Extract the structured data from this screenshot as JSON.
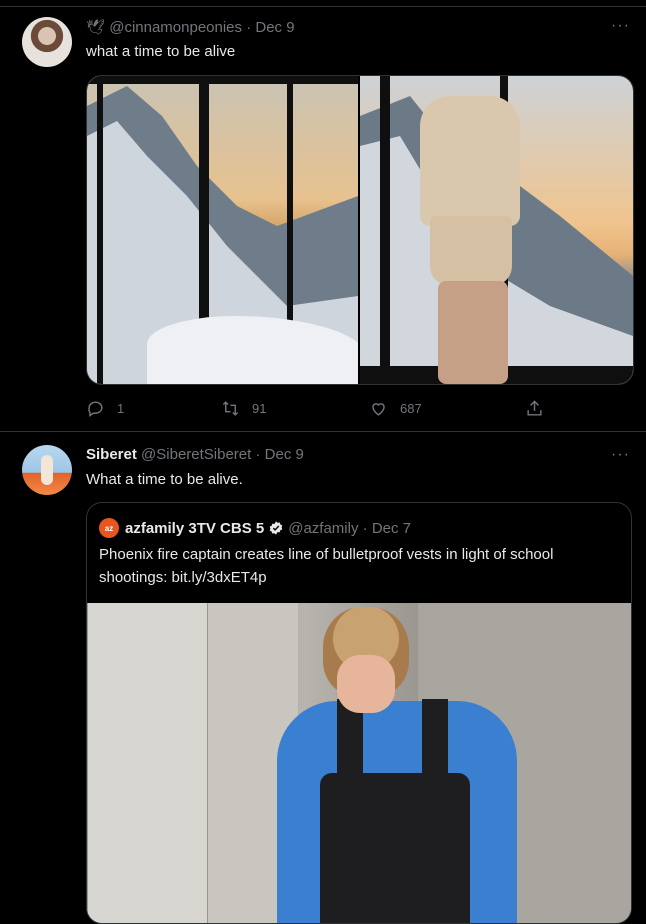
{
  "tweets": [
    {
      "handle": "@cinnamonpeonies",
      "separator": "·",
      "date": "Dec 9",
      "more": "···",
      "text": "what a time to be alive",
      "stats": {
        "replies": "1",
        "retweets": "91",
        "likes": "687"
      }
    },
    {
      "name": "Siberet",
      "handle": "@SiberetSiberet",
      "separator": "·",
      "date": "Dec 9",
      "more": "···",
      "text": "What a time to be alive.",
      "quote": {
        "avatar_text": "az",
        "name": "azfamily 3TV CBS 5",
        "handle": "@azfamily",
        "separator": "·",
        "date": "Dec 7",
        "text": "Phoenix fire captain creates line of bulletproof vests in light of school shootings: bit.ly/3dxET4p"
      }
    }
  ],
  "colors": {
    "background": "#000000",
    "text": "#e7e9ea",
    "muted": "#71767b",
    "border": "#2f3336",
    "verified": "#e7e9ea"
  },
  "icons": [
    "bird-badge-icon",
    "more-icon",
    "reply-icon",
    "retweet-icon",
    "like-icon",
    "share-icon",
    "verified-icon"
  ]
}
